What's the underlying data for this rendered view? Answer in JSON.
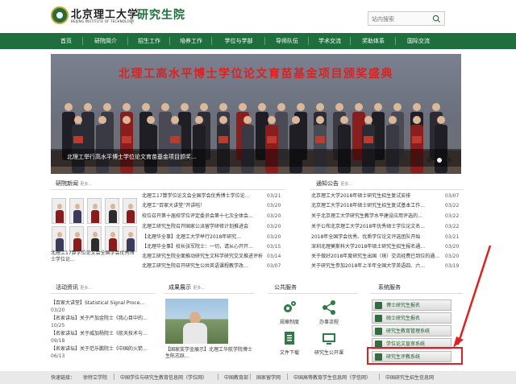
{
  "header": {
    "logo_cn": "北京理工大学",
    "logo_en": "BEIJING INSTITUTE OF TECHNOLOGY",
    "site_title": "研究生院",
    "search_placeholder": "站内搜索"
  },
  "nav": [
    "首页",
    "研院简介",
    "招生工作",
    "培养工作",
    "学位与学部",
    "导师队伍",
    "学术交流",
    "奖助体系",
    "国际交流"
  ],
  "banner": {
    "title": "北理工高水平博士学位论文育苗基金项目颁奖盛典",
    "caption": "北理工举行高水平博士学位论文育苗基金项目颁奖..."
  },
  "research_news": {
    "title": "研院新闻",
    "more": "更多...",
    "photo_caption": "北理工17算学位论文会全国学会优秀博士学位论...",
    "items": [
      {
        "text": "北理工17算学位论文会全国学会优秀博士学位论...",
        "date": "03/21"
      },
      {
        "text": "北理工“百家大讲堂”开讲啦！",
        "date": "03/20"
      },
      {
        "text": "校位召开第十届校学位评定委员会第十七次全体会...",
        "date": "03/20"
      },
      {
        "text": "北理工研究生院召开国家公派留学研修计划推进会",
        "date": "03/20"
      },
      {
        "text": "【北理华全事】北理工大学举行2018年研究...",
        "date": "03/20"
      },
      {
        "text": "【北理华全事】校长张军院士：一切，请从心开开...",
        "date": "03/15"
      },
      {
        "text": "北理工研究生院全面推动研究生文科学研究交叉推进评析",
        "date": "03/14"
      },
      {
        "text": "北理工研究生院召开研究生公共英语课程教学改...",
        "date": "03/07"
      }
    ]
  },
  "notices": {
    "title": "通知公告",
    "more": "更多...",
    "items": [
      {
        "text": "北京理工大学2018年硕士研究生招生复试安排",
        "date": "03/07"
      },
      {
        "text": "北京理工大学2018年硕士研究生招生复试基本工作...",
        "date": "03/22"
      },
      {
        "text": "关于北京理工大学研究生教学水平建设应用评选的...",
        "date": "03/22"
      },
      {
        "text": "关于公布北京理工大学2018年优秀硕士学位论文名...",
        "date": "03/22"
      },
      {
        "text": "2018年全国学会优秀、优质学位论文评选团队开始",
        "date": "03/21"
      },
      {
        "text": "深圳北理莫斯科大学2018年硕士研究生招生报名通...",
        "date": "03/20"
      },
      {
        "text": "关于做好2018年度研究生出国（境）交流经费已到位的通...",
        "date": "03/20"
      },
      {
        "text": "关于研究生参加2018年上半年全国大学英语四、六...",
        "date": "03/19"
      }
    ]
  },
  "activities": {
    "title": "活动资讯",
    "more": "更多...",
    "items": [
      {
        "text": "【百家大讲堂】Statistical Signal Proce...",
        "date": "03/20"
      },
      {
        "text": "【名家讲坛】关于严加金院士《我心目中的...",
        "date": "10/25"
      },
      {
        "text": "【名家讲坛】关于威加杨院士《航天技术与...",
        "date": "09/18"
      },
      {
        "text": "【名家讲坛】关于范乐鹏院士《中国的火箭...",
        "date": "06/13"
      }
    ]
  },
  "showcase": {
    "title": "成果展示",
    "more": "更多...",
    "caption": "【国家奖学金展示】北理工华航学院博士生陈志跃..."
  },
  "public_services": {
    "title": "公共服务",
    "items": [
      "规章制度",
      "办事流程",
      "文件下载",
      "研究生公开课"
    ]
  },
  "systems": {
    "title": "系统服务",
    "items": [
      "博士研究生报名",
      "硕士研究生报名",
      "研究生教育管理系统",
      "学位论文盲审系统",
      "研究生评教系统"
    ]
  },
  "footer": {
    "label": "快速链接：",
    "links": [
      "徐特立学院",
      "中国学位与研究生教育信息网（学位网）",
      "中国教育部",
      "国家留学网",
      "中国高等教育学生信息网（学信网）",
      "中国研究生招生信息网"
    ]
  },
  "colors": {
    "brand": "#1e6e3e",
    "highlight": "#e02020"
  }
}
